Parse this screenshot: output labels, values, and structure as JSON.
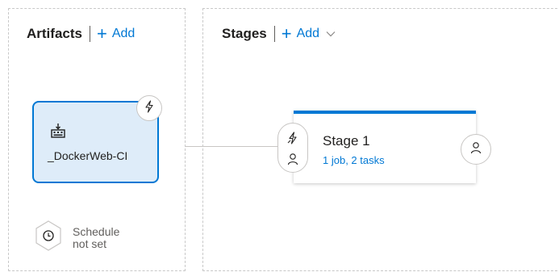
{
  "artifacts_section": {
    "title": "Artifacts",
    "add_label": "Add"
  },
  "artifact": {
    "name": "_DockerWeb-CI",
    "icon": "build-pipeline-icon",
    "trigger_icon": "lightning-icon"
  },
  "schedule": {
    "line1": "Schedule",
    "line2": "not set",
    "icon": "clock-icon"
  },
  "stages_section": {
    "title": "Stages",
    "add_label": "Add"
  },
  "stage": {
    "name": "Stage 1",
    "summary": "1 job, 2 tasks",
    "pre_deployment_icons": [
      "lightning-icon",
      "person-icon"
    ],
    "post_deployment_icon": "person-icon"
  },
  "colors": {
    "accent": "#0078d4",
    "card_bg": "#deecf9"
  }
}
